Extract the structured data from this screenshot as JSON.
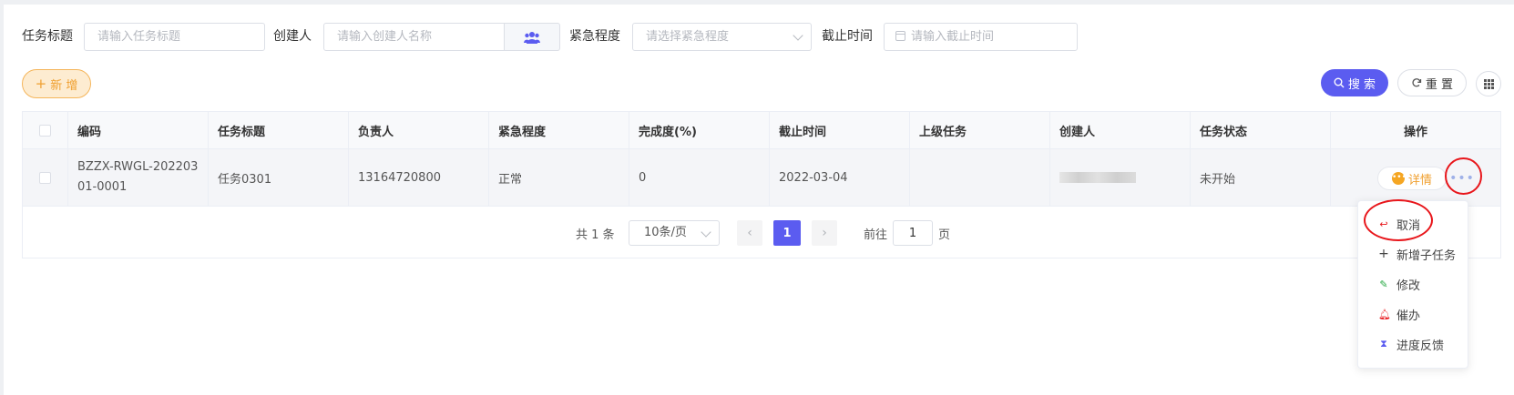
{
  "filters": {
    "title_label": "任务标题",
    "title_placeholder": "请输入任务标题",
    "creator_label": "创建人",
    "creator_placeholder": "请输入创建人名称",
    "urgency_label": "紧急程度",
    "urgency_placeholder": "请选择紧急程度",
    "deadline_label": "截止时间",
    "deadline_placeholder": "请输入截止时间"
  },
  "toolbar": {
    "add_label": "新 增",
    "search_label": "搜 索",
    "reset_label": "重 置"
  },
  "table": {
    "columns": [
      "编码",
      "任务标题",
      "负责人",
      "紧急程度",
      "完成度(%)",
      "截止时间",
      "上级任务",
      "创建人",
      "任务状态",
      "操作"
    ],
    "rows": [
      {
        "code": "BZZX-RWGL-20220301-0001",
        "title": "任务0301",
        "owner": "13164720800",
        "urgency": "正常",
        "completion": "0",
        "deadline": "2022-03-04",
        "parent_task": "",
        "creator": "",
        "status": "未开始",
        "detail_label": "详情",
        "more_label": "•••"
      }
    ]
  },
  "pagination": {
    "total": "共 1 条",
    "page_size": "10条/页",
    "current_page": "1",
    "goto_label": "前往",
    "goto_value": "1",
    "page_suffix": "页"
  },
  "dropdown_menu": {
    "items": [
      {
        "label": "取消",
        "icon": "cancel-icon",
        "color": "#e8161b"
      },
      {
        "label": "新增子任务",
        "icon": "plus-icon",
        "color": "#444444"
      },
      {
        "label": "修改",
        "icon": "edit-icon",
        "color": "#27a844"
      },
      {
        "label": "催办",
        "icon": "bell-icon",
        "color": "#e8161b"
      },
      {
        "label": "进度反馈",
        "icon": "hourglass-icon",
        "color": "#5b5cf0"
      }
    ]
  },
  "colors": {
    "primary": "#5b5cf0",
    "warning": "#f0a030",
    "highlight_circle": "#e8161b"
  }
}
